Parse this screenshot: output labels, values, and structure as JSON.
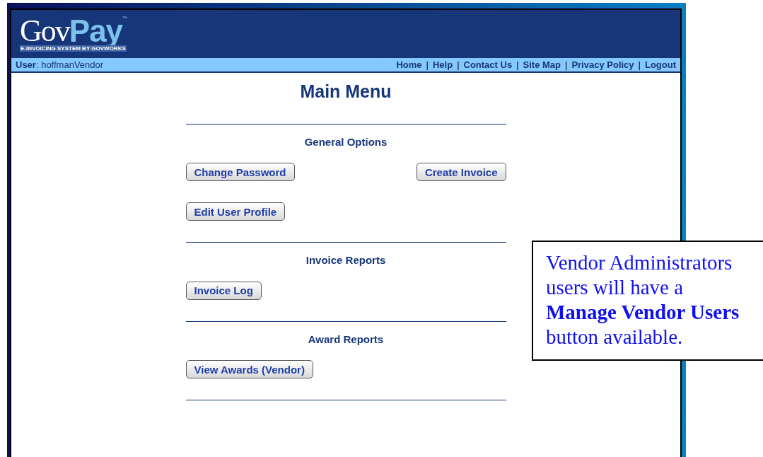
{
  "header": {
    "logo": {
      "part_1": "Gov",
      "part_2": "Pay",
      "trademark": "™",
      "tagline": "E-INVOICING SYSTEM BY GOVWORKS"
    },
    "user_label": "User",
    "user_separator": ":",
    "user_name": "hoffmanVendor",
    "nav_links": [
      "Home",
      "Help",
      "Contact Us",
      "Site Map",
      "Privacy Policy",
      "Logout"
    ],
    "separator": "|"
  },
  "title": "Main Menu",
  "sections": [
    {
      "heading": "General Options",
      "rows": [
        [
          "Change Password",
          "Create Invoice"
        ],
        [
          "Edit User Profile"
        ]
      ]
    },
    {
      "heading": "Invoice Reports",
      "rows": [
        [
          "Invoice Log"
        ]
      ]
    },
    {
      "heading": "Award Reports",
      "rows": [
        [
          "View Awards (Vendor)"
        ]
      ]
    }
  ],
  "callout": "Vendor Administrators users will have a **Manage Vendor Users** button available."
}
